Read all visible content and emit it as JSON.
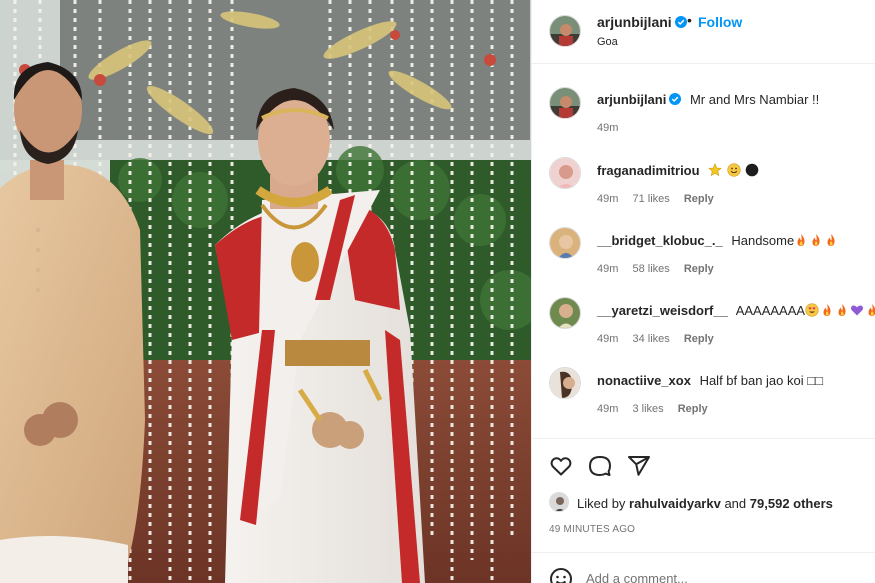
{
  "header": {
    "username": "arjunbijlani",
    "separator": "•",
    "follow_label": "Follow",
    "location": "Goa"
  },
  "caption": {
    "username": "arjunbijlani",
    "text": "Mr and Mrs Nambiar !!",
    "time": "49m"
  },
  "comments": [
    {
      "username": "fraganadimitriou",
      "text": "",
      "emojis": [
        "star",
        "smiley",
        "black-circle"
      ],
      "time": "49m",
      "likes": "71 likes",
      "reply": "Reply"
    },
    {
      "username": "__bridget_klobuc_._",
      "text": "Handsome",
      "emojis": [
        "fire",
        "fire",
        "fire"
      ],
      "time": "49m",
      "likes": "58 likes",
      "reply": "Reply"
    },
    {
      "username": "__yaretzi_weisdorf__",
      "text": "AAAAAAAA",
      "emojis": [
        "heart-eyes",
        "fire",
        "fire",
        "purple-heart",
        "fire"
      ],
      "time": "49m",
      "likes": "34 likes",
      "reply": "Reply"
    },
    {
      "username": "nonactiive_xox",
      "text": "Half bf ban jao koi □□",
      "emojis": [],
      "time": "49m",
      "likes": "3 likes",
      "reply": "Reply"
    }
  ],
  "likes": {
    "prefix": "Liked by",
    "user": "rahulvaidyarkv",
    "middle": "and",
    "count": "79,592 others"
  },
  "timestamp": "49 MINUTES AGO",
  "add_comment": {
    "placeholder": "Add a comment..."
  },
  "colors": {
    "accent": "#0095f6",
    "verified": "#0095f6",
    "muted": "#737373",
    "divider": "#efefef"
  },
  "icons": [
    "verified-badge-icon",
    "heart-icon",
    "comment-icon",
    "share-icon",
    "emoji-icon"
  ]
}
